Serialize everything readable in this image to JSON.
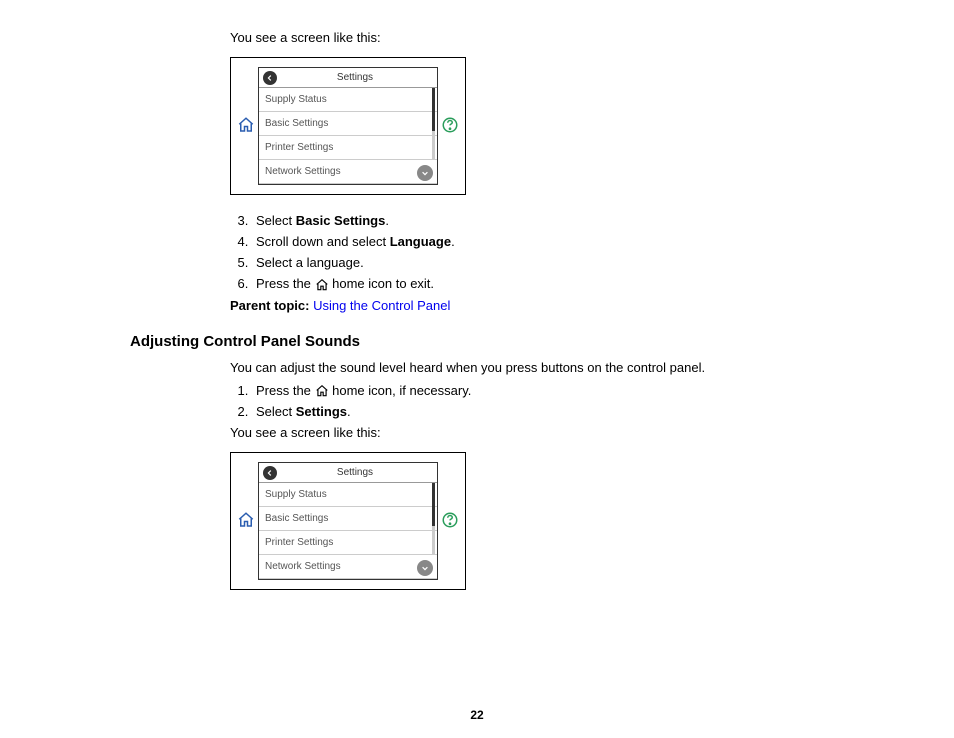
{
  "intro1": "You see a screen like this:",
  "figure": {
    "title": "Settings",
    "rows": [
      "Supply Status",
      "Basic Settings",
      "Printer Settings",
      "Network Settings"
    ]
  },
  "steps_a": {
    "start": 3,
    "items": [
      {
        "prefix": "Select ",
        "bold": "Basic Settings",
        "suffix": "."
      },
      {
        "prefix": "Scroll down and select ",
        "bold": "Language",
        "suffix": "."
      },
      {
        "text": "Select a language."
      },
      {
        "prefix": "Press the ",
        "icon": true,
        "suffix": " home icon to exit."
      }
    ]
  },
  "parent_topic_label": "Parent topic: ",
  "parent_topic_link": "Using the Control Panel",
  "heading": "Adjusting Control Panel Sounds",
  "section_intro": "You can adjust the sound level heard when you press buttons on the control panel.",
  "steps_b": {
    "start": 1,
    "items": [
      {
        "prefix": "Press the ",
        "icon": true,
        "suffix": " home icon, if necessary."
      },
      {
        "prefix": "Select ",
        "bold": "Settings",
        "suffix": "."
      }
    ]
  },
  "intro2": "You see a screen like this:",
  "page_number": "22"
}
